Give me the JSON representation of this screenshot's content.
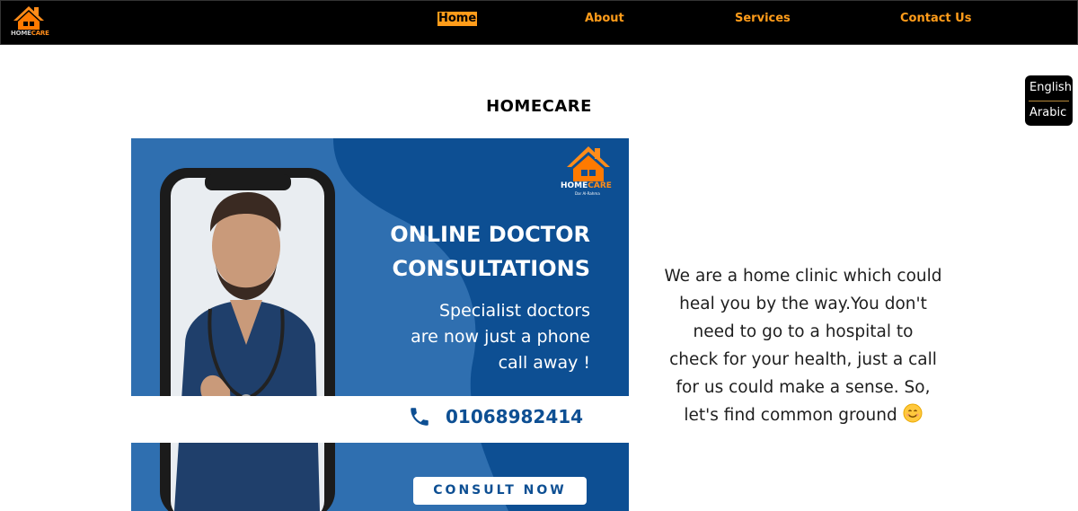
{
  "nav": {
    "logo_text_white": "HOME",
    "logo_text_orange": "CARE",
    "logo_tagline": "Dar Al-Rahma",
    "links": [
      {
        "label": "Home",
        "active": true
      },
      {
        "label": "About",
        "active": false
      },
      {
        "label": "Services",
        "active": false
      },
      {
        "label": "Contact Us",
        "active": false
      }
    ]
  },
  "language": {
    "english": "English",
    "arabic": "Arabic"
  },
  "page_title": "HOMECARE",
  "banner": {
    "logo_text_white": "HOME",
    "logo_text_orange": "CARE",
    "logo_tagline": "Dar Al-Rahma",
    "headline_line1": "ONLINE DOCTOR",
    "headline_line2": "CONSULTATIONS",
    "sub_line1": "Specialist doctors",
    "sub_line2": "are now just a phone",
    "sub_line3": "call away !",
    "phone": "01068982414",
    "button_label": "CONSULT NOW"
  },
  "about": {
    "line1": "We are a home clinic which could",
    "line2": "heal you by the way.You don't",
    "line3": "need to go to a hospital to",
    "line4": "check for your health, just a call",
    "line5": "for us could make a sense. So,",
    "line6": "let's find common ground"
  },
  "colors": {
    "accent": "#ff9c1a",
    "nav_bg": "#000000",
    "banner_blue": "#0d4f93",
    "banner_light_blue": "#2f6fb0"
  },
  "icons": [
    "house-logo-icon",
    "phone-icon",
    "smile-emoji-icon"
  ]
}
